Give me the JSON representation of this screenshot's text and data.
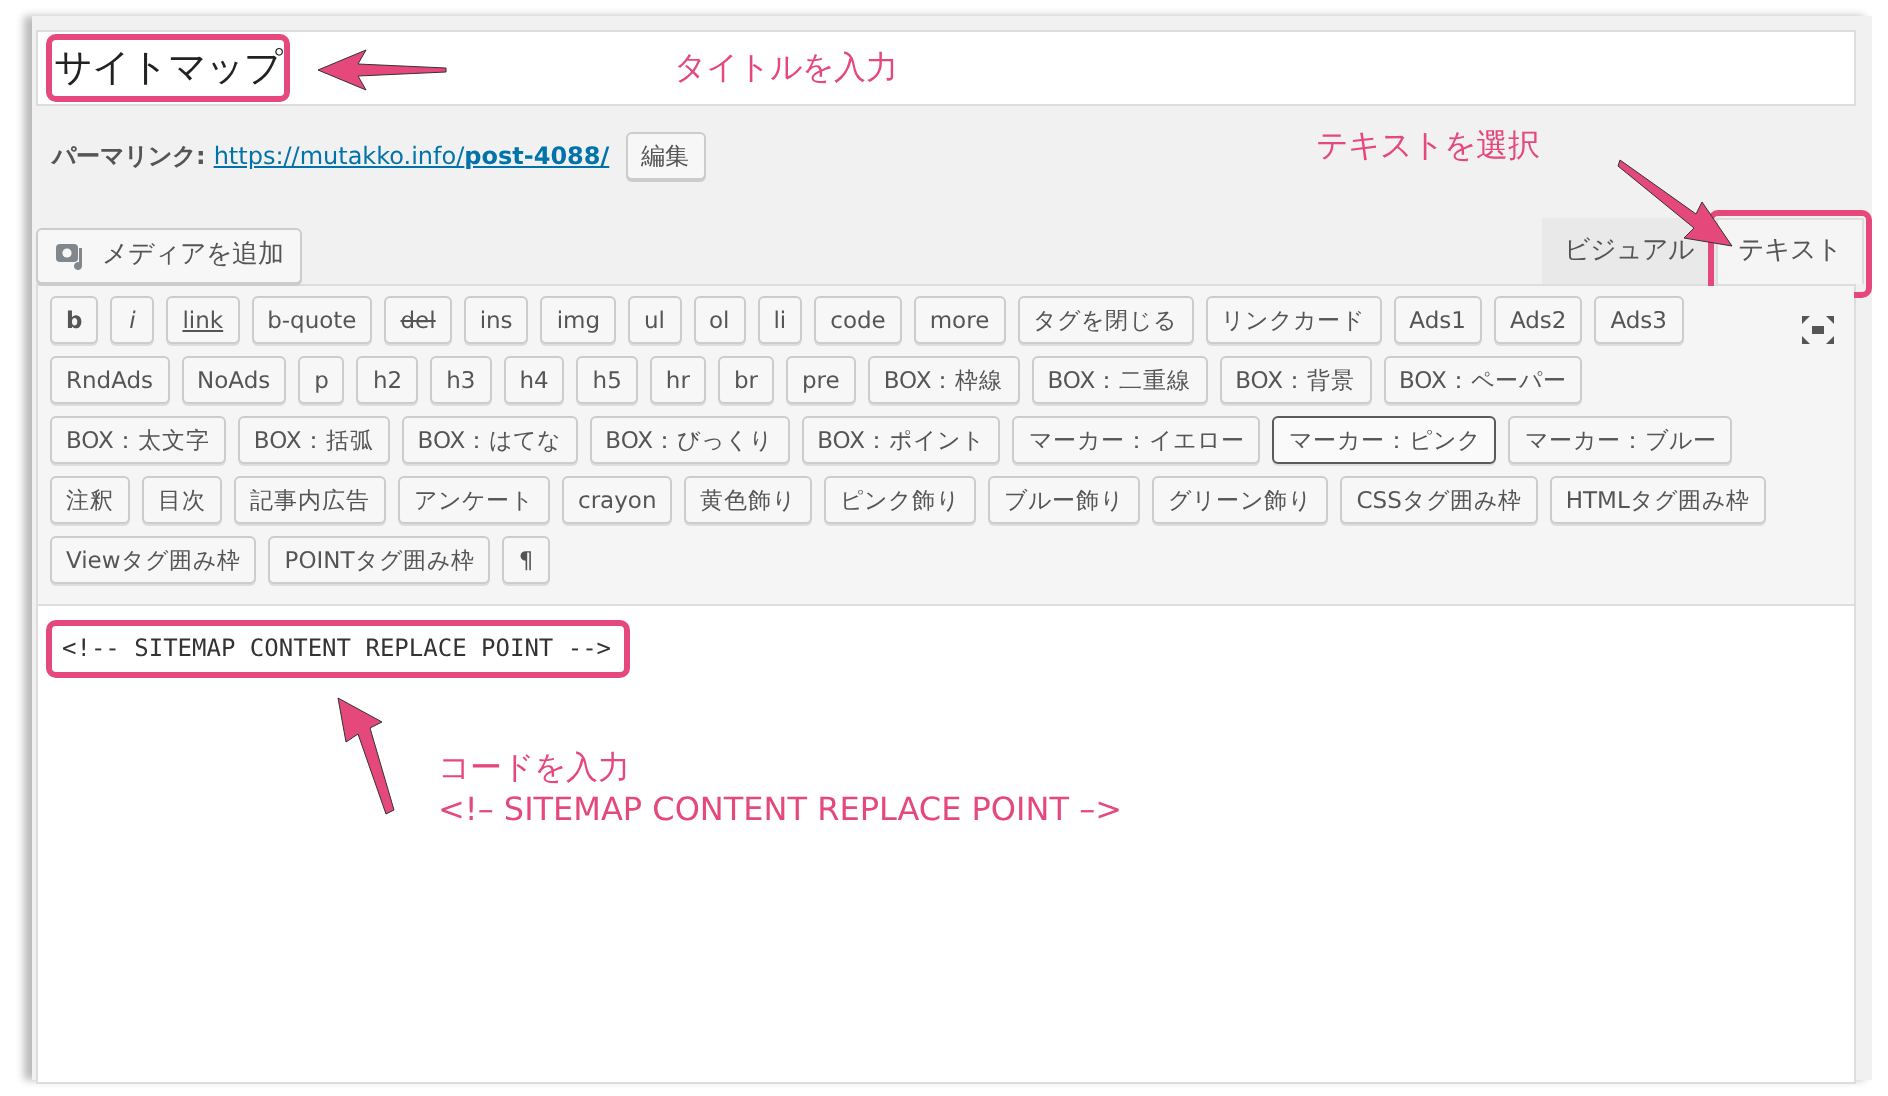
{
  "title": {
    "value": "サイトマップ",
    "highlighted": true
  },
  "title_annotation": {
    "text": "タイトルを入力"
  },
  "permalink": {
    "label": "パーマリンク:",
    "url": "https://mutakko.info/**post-4088/**",
    "edit_button": "編集"
  },
  "media_button": {
    "label": "メディアを追加"
  },
  "tab_annotation": {
    "text": "テキストを選択"
  },
  "tabs": [
    {
      "label": "ビジュアル",
      "selected": false,
      "highlighted": false
    },
    {
      "label": "テキスト",
      "selected": true,
      "highlighted": true
    }
  ],
  "toolbar": {
    "buttons": [
      {
        "label": "b",
        "kind": "bold",
        "focused": false
      },
      {
        "label": "i",
        "kind": "italic",
        "focused": false,
        "new_row": false
      },
      {
        "label": "link",
        "kind": "underline",
        "focused": false,
        "new_row": false
      },
      {
        "label": "b-quote",
        "kind": "plain",
        "focused": false,
        "new_row": false
      },
      {
        "label": "del",
        "kind": "strike",
        "focused": false,
        "new_row": false
      },
      {
        "label": "ins",
        "kind": "plain",
        "focused": false,
        "new_row": false
      },
      {
        "label": "img",
        "kind": "plain",
        "focused": false,
        "new_row": false
      },
      {
        "label": "ul",
        "kind": "plain",
        "focused": false,
        "new_row": false
      },
      {
        "label": "ol",
        "kind": "plain",
        "focused": false,
        "new_row": false
      },
      {
        "label": "li",
        "kind": "plain",
        "focused": false,
        "new_row": false
      },
      {
        "label": "code",
        "kind": "plain",
        "focused": false,
        "new_row": false
      },
      {
        "label": "more",
        "kind": "plain",
        "focused": false,
        "new_row": false
      },
      {
        "label": "タグを閉じる",
        "kind": "plain",
        "focused": false,
        "new_row": false
      },
      {
        "label": "リンクカード",
        "kind": "plain",
        "focused": false,
        "new_row": false
      },
      {
        "label": "Ads1",
        "kind": "plain",
        "focused": false,
        "new_row": false
      },
      {
        "label": "Ads2",
        "kind": "plain",
        "focused": false,
        "new_row": false
      },
      {
        "label": "Ads3",
        "kind": "plain",
        "focused": false,
        "new_row": false
      },
      {
        "label": "RndAds",
        "kind": "plain",
        "focused": false,
        "new_row": true
      },
      {
        "label": "NoAds",
        "kind": "plain",
        "focused": false,
        "new_row": false
      },
      {
        "label": "p",
        "kind": "plain",
        "focused": false,
        "new_row": false
      },
      {
        "label": "h2",
        "kind": "plain",
        "focused": false,
        "new_row": false
      },
      {
        "label": "h3",
        "kind": "plain",
        "focused": false,
        "new_row": false
      },
      {
        "label": "h4",
        "kind": "plain",
        "focused": false,
        "new_row": false
      },
      {
        "label": "h5",
        "kind": "plain",
        "focused": false,
        "new_row": false
      },
      {
        "label": "hr",
        "kind": "plain",
        "focused": false,
        "new_row": false
      },
      {
        "label": "br",
        "kind": "plain",
        "focused": false,
        "new_row": false
      },
      {
        "label": "pre",
        "kind": "plain",
        "focused": false,
        "new_row": false
      },
      {
        "label": "BOX：枠線",
        "kind": "plain",
        "focused": false,
        "new_row": false
      },
      {
        "label": "BOX：二重線",
        "kind": "plain",
        "focused": false,
        "new_row": false
      },
      {
        "label": "BOX：背景",
        "kind": "plain",
        "focused": false,
        "new_row": false
      },
      {
        "label": "BOX：ペーパー",
        "kind": "plain",
        "focused": false,
        "new_row": false
      },
      {
        "label": "BOX：太文字",
        "kind": "plain",
        "focused": false,
        "new_row": true
      },
      {
        "label": "BOX：括弧",
        "kind": "plain",
        "focused": false,
        "new_row": false
      },
      {
        "label": "BOX：はてな",
        "kind": "plain",
        "focused": false,
        "new_row": false
      },
      {
        "label": "BOX：びっくり",
        "kind": "plain",
        "focused": false,
        "new_row": false
      },
      {
        "label": "BOX：ポイント",
        "kind": "plain",
        "focused": false,
        "new_row": false
      },
      {
        "label": "マーカー：イエロー",
        "kind": "plain",
        "focused": false,
        "new_row": false
      },
      {
        "label": "マーカー：ピンク",
        "kind": "plain",
        "focused": true,
        "new_row": false
      },
      {
        "label": "マーカー：ブルー",
        "kind": "plain",
        "focused": false,
        "new_row": false
      },
      {
        "label": "注釈",
        "kind": "plain",
        "focused": false,
        "new_row": true
      },
      {
        "label": "目次",
        "kind": "plain",
        "focused": false,
        "new_row": false
      },
      {
        "label": "記事内広告",
        "kind": "plain",
        "focused": false,
        "new_row": false
      },
      {
        "label": "アンケート",
        "kind": "plain",
        "focused": false,
        "new_row": false
      },
      {
        "label": "crayon",
        "kind": "plain",
        "focused": false,
        "new_row": false
      },
      {
        "label": "黄色飾り",
        "kind": "plain",
        "focused": false,
        "new_row": false
      },
      {
        "label": "ピンク飾り",
        "kind": "plain",
        "focused": false,
        "new_row": false
      },
      {
        "label": "ブルー飾り",
        "kind": "plain",
        "focused": false,
        "new_row": false
      },
      {
        "label": "グリーン飾り",
        "kind": "plain",
        "focused": false,
        "new_row": false
      },
      {
        "label": "CSSタグ囲み枠",
        "kind": "plain",
        "focused": false,
        "new_row": false
      },
      {
        "label": "HTMLタグ囲み枠",
        "kind": "plain",
        "focused": false,
        "new_row": false
      },
      {
        "label": "Viewタグ囲み枠",
        "kind": "plain",
        "focused": false,
        "new_row": true
      },
      {
        "label": "POINTタグ囲み枠",
        "kind": "plain",
        "focused": false,
        "new_row": false
      },
      {
        "label": "¶",
        "kind": "plain",
        "focused": false,
        "new_row": false
      }
    ]
  },
  "content": {
    "code": "<!-- SITEMAP CONTENT REPLACE POINT -->",
    "highlighted": true
  },
  "code_annotation": {
    "lines": [
      "コードを入力",
      "<!– SITEMAP CONTENT REPLACE POINT –>"
    ]
  }
}
